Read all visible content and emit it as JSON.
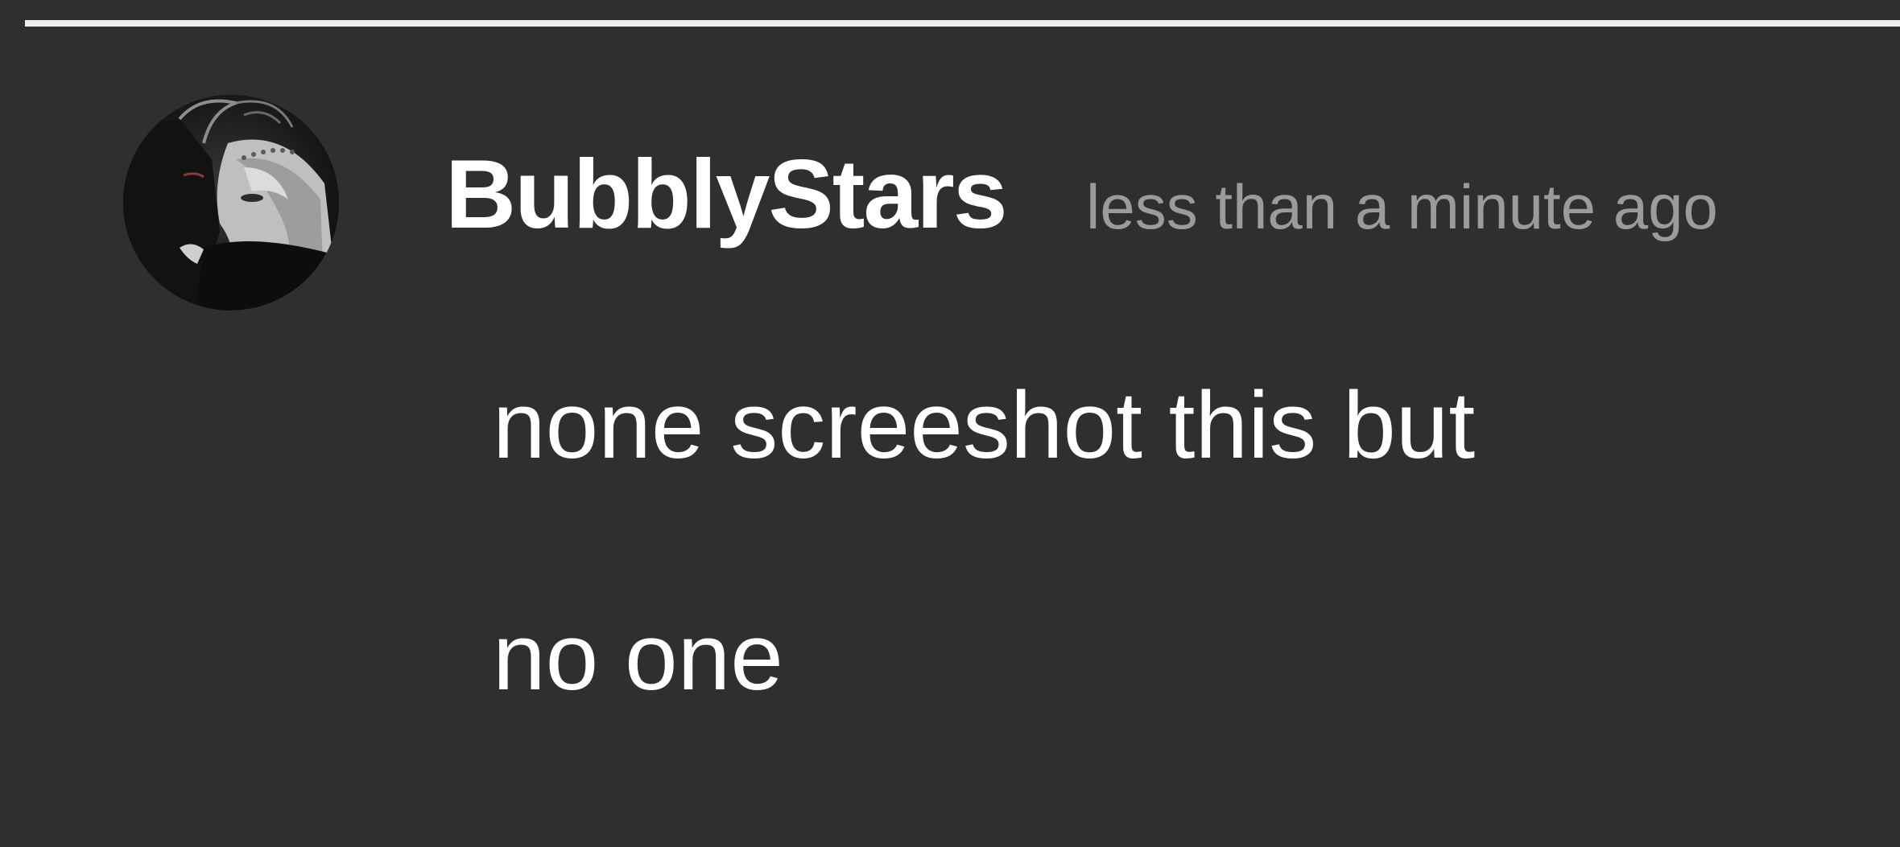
{
  "comment": {
    "username": "BubblyStars",
    "timestamp": "less than a minute ago",
    "message_lines": [
      "none screeshot this but",
      "no one"
    ]
  },
  "colors": {
    "background": "#2f2f2f",
    "text_primary": "#ffffff",
    "text_secondary": "#9b9b9b",
    "divider": "#ededed"
  },
  "icons": {
    "avatar": "user-avatar-anime-art"
  }
}
